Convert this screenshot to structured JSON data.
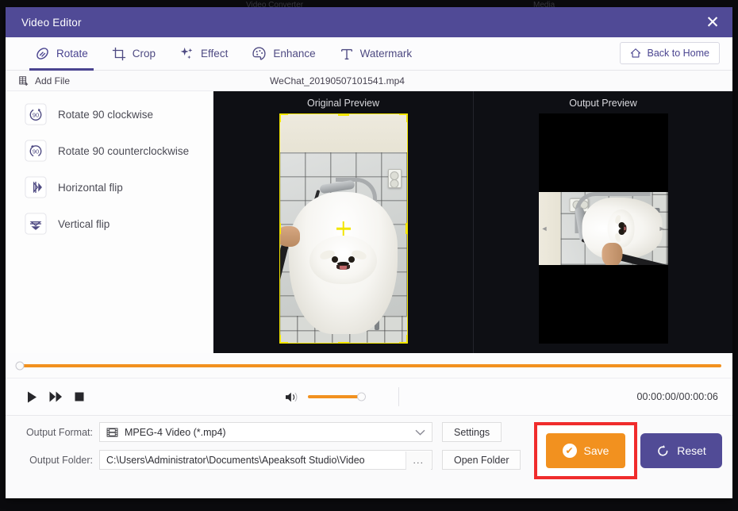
{
  "background_window": {
    "label_left": "Video Converter",
    "label_right": "Media"
  },
  "window": {
    "title": "Video Editor",
    "close_label": "✕"
  },
  "tabs": [
    {
      "label": "Rotate",
      "icon": "rotate-icon",
      "active": true
    },
    {
      "label": "Crop",
      "icon": "crop-icon",
      "active": false
    },
    {
      "label": "Effect",
      "icon": "effect-sparkle-icon",
      "active": false
    },
    {
      "label": "Enhance",
      "icon": "enhance-icon",
      "active": false
    },
    {
      "label": "Watermark",
      "icon": "watermark-text-icon",
      "active": false
    }
  ],
  "back_to_home": {
    "label": "Back to Home",
    "icon": "home-icon"
  },
  "sidebar": {
    "items": [
      {
        "label": "Rotate 90 clockwise",
        "icon": "rotate-cw-90-icon"
      },
      {
        "label": "Rotate 90 counterclockwise",
        "icon": "rotate-ccw-90-icon"
      },
      {
        "label": "Horizontal flip",
        "icon": "horizontal-flip-icon"
      },
      {
        "label": "Vertical flip",
        "icon": "vertical-flip-icon"
      }
    ]
  },
  "filebar": {
    "add_file_label": "Add File",
    "add_file_icon": "add-file-icon",
    "filename": "WeChat_20190507101541.mp4"
  },
  "preview": {
    "original_title": "Original Preview",
    "output_title": "Output Preview"
  },
  "transport": {
    "play_icon": "play-icon",
    "forward_icon": "fast-forward-icon",
    "stop_icon": "stop-icon",
    "volume_icon": "volume-icon",
    "time": "00:00:00/00:00:06"
  },
  "output": {
    "format_label": "Output Format:",
    "format_value": "MPEG-4 Video (*.mp4)",
    "format_icon": "mpeg-film-icon",
    "folder_label": "Output Folder:",
    "folder_value": "C:\\Users\\Administrator\\Documents\\Apeaksoft Studio\\Video",
    "browse_label": "...",
    "settings_label": "Settings",
    "open_folder_label": "Open Folder"
  },
  "actions": {
    "save_label": "Save",
    "save_icon": "check-circle-icon",
    "reset_label": "Reset",
    "reset_icon": "reset-arrow-icon"
  },
  "colors": {
    "brand_purple": "#504a96",
    "accent_orange": "#f2911f",
    "highlight_red": "#f02c2c",
    "crop_yellow": "#f2e500",
    "stage_black": "#0e0f14"
  }
}
